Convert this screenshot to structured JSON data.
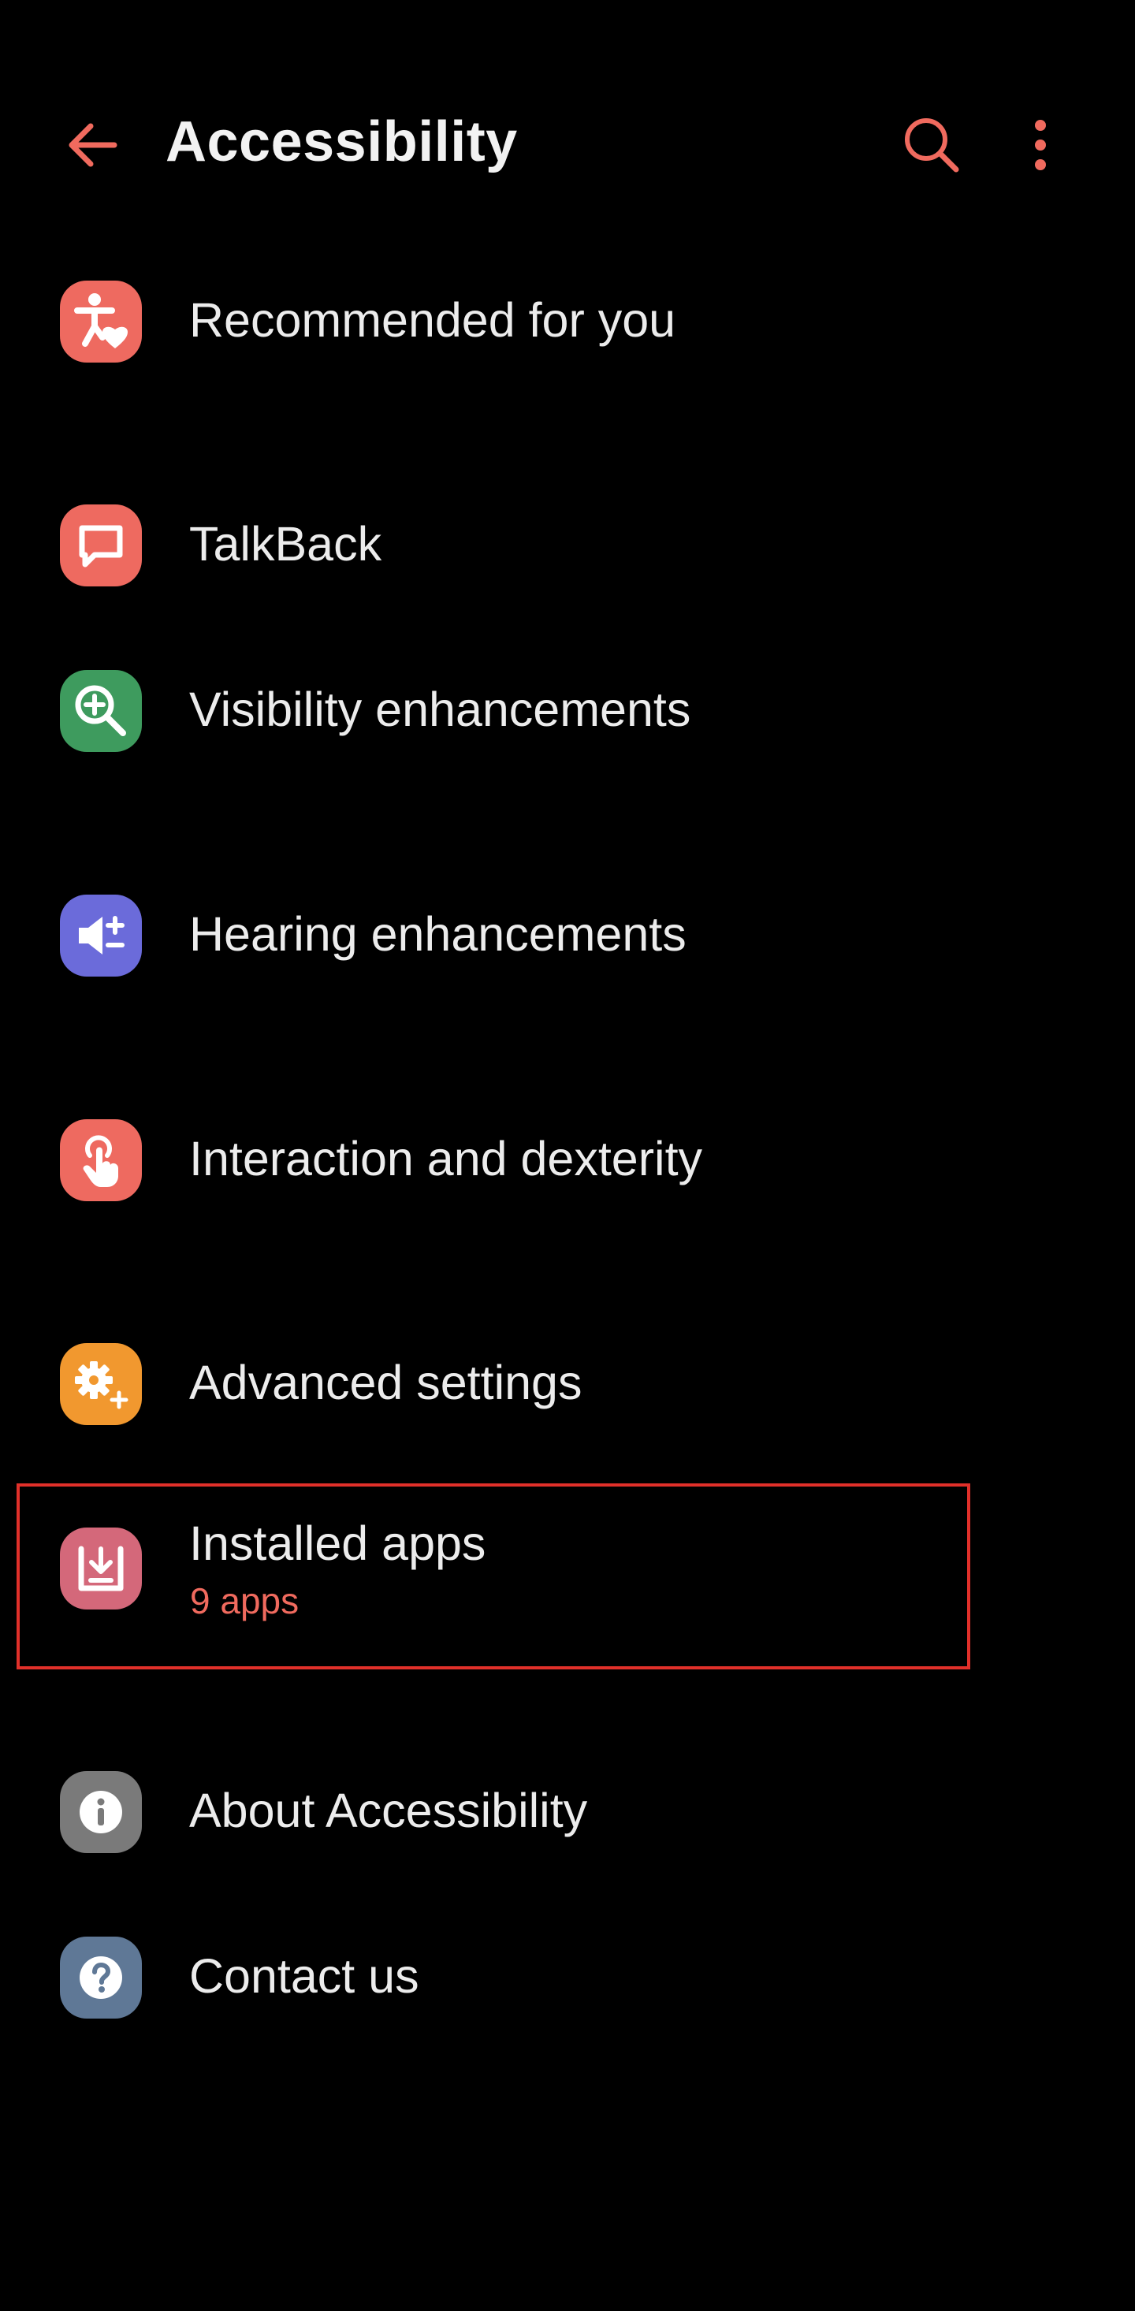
{
  "header": {
    "title": "Accessibility",
    "back_icon": "arrow-left-icon",
    "search_icon": "search-icon",
    "more_icon": "more-vertical-icon",
    "accent_color": "#F06A5E"
  },
  "items": [
    {
      "label": "Recommended for you",
      "icon": "accessibility-heart-icon",
      "color": "#EE6A60"
    },
    {
      "label": "TalkBack",
      "icon": "speech-bubble-icon",
      "color": "#EE6A60"
    },
    {
      "label": "Visibility enhancements",
      "icon": "zoom-in-icon",
      "color": "#3E9B5E"
    },
    {
      "label": "Hearing enhancements",
      "icon": "volume-plus-minus-icon",
      "color": "#6B6BDA"
    },
    {
      "label": "Interaction and dexterity",
      "icon": "touch-hand-icon",
      "color": "#EE6A60"
    },
    {
      "label": "Advanced settings",
      "icon": "gear-plus-icon",
      "color": "#F1982F"
    },
    {
      "label": "Installed apps",
      "sub": "9 apps",
      "icon": "download-tray-icon",
      "color": "#D4687A"
    },
    {
      "label": "About Accessibility",
      "icon": "info-icon",
      "color": "#7A7A7A"
    },
    {
      "label": "Contact us",
      "icon": "help-icon",
      "color": "#5F7896"
    }
  ]
}
